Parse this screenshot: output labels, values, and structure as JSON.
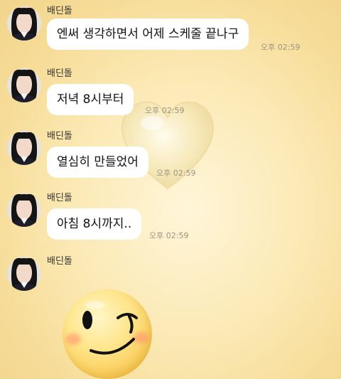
{
  "messages": [
    {
      "sender": "배딘돌",
      "text": "엔써 생각하면서 어제 스케줄 끝나구",
      "time": "오후 02:59"
    },
    {
      "sender": "배딘돌",
      "text": "저녁 8시부터",
      "time": "오후 02:59"
    },
    {
      "sender": "배딘돌",
      "text": "열심히 만들었어",
      "time": "오후 02:59"
    },
    {
      "sender": "배딘돌",
      "text": "아침 8시까지..",
      "time": "오후 02:59"
    },
    {
      "sender": "배딘돌",
      "emoticon": "wink-face-emoticon"
    }
  ],
  "background": {
    "decoration": "heart-icon",
    "colors": [
      "#fff6d9",
      "#f6dc98"
    ]
  },
  "colors": {
    "bubble": "#ffffff",
    "time_text": "#9a9486"
  }
}
